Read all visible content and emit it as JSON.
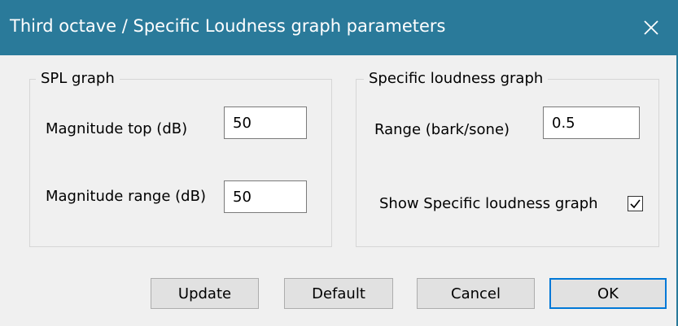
{
  "window": {
    "title": "Third octave / Specific Loudness graph parameters",
    "close_icon": "close-icon"
  },
  "spl_group": {
    "legend": "SPL graph",
    "magnitude_top_label": "Magnitude top (dB)",
    "magnitude_top_value": "50",
    "magnitude_range_label": "Magnitude range (dB)",
    "magnitude_range_value": "50"
  },
  "loudness_group": {
    "legend": "Specific loudness graph",
    "range_label": "Range (bark/sone)",
    "range_value": "0.5",
    "show_graph_label": "Show Specific loudness graph",
    "show_graph_checked": true
  },
  "buttons": {
    "update": "Update",
    "default": "Default",
    "cancel": "Cancel",
    "ok": "OK"
  },
  "colors": {
    "titlebar": "#2a7a9a",
    "accent": "#0078d7",
    "background": "#f0f0f0"
  }
}
